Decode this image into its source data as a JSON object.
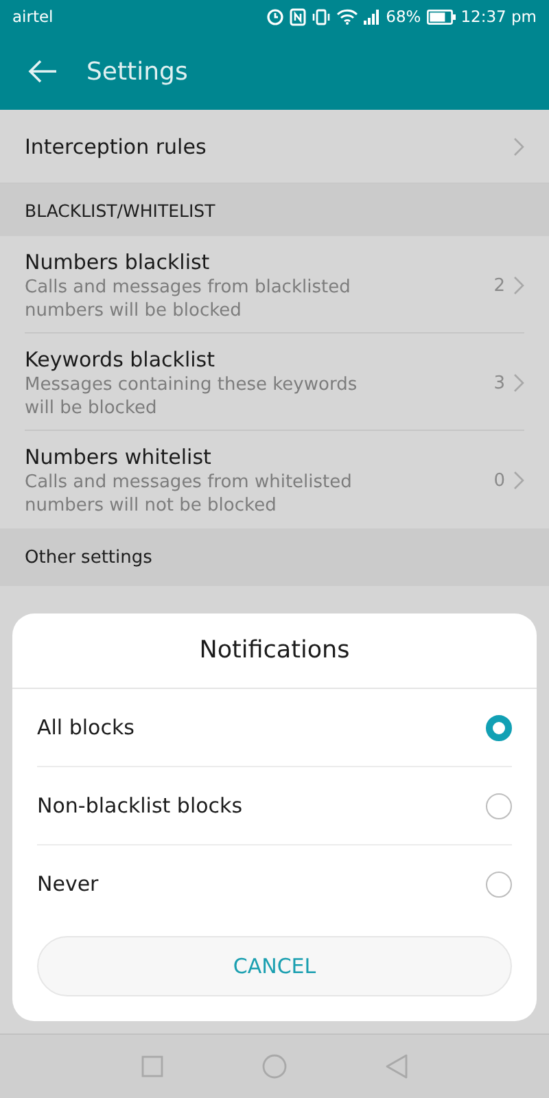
{
  "status_bar": {
    "carrier": "airtel",
    "battery_text": "68%",
    "time": "12:37 pm"
  },
  "app_bar": {
    "title": "Settings"
  },
  "interception_rules": {
    "label": "Interception rules"
  },
  "section": {
    "title": "BLACKLIST/WHITELIST"
  },
  "list_items": [
    {
      "title": "Numbers blacklist",
      "subtitle": "Calls and messages from blacklisted numbers will be blocked",
      "count": "2"
    },
    {
      "title": "Keywords blacklist",
      "subtitle": "Messages containing these keywords will be blocked",
      "count": "3"
    },
    {
      "title": "Numbers whitelist",
      "subtitle": "Calls and messages from whitelisted numbers will not be blocked",
      "count": "0"
    }
  ],
  "other_settings": {
    "title": "Other settings"
  },
  "dialog": {
    "title": "Notifications",
    "options": [
      {
        "label": "All blocks",
        "selected": true
      },
      {
        "label": "Non-blacklist blocks",
        "selected": false
      },
      {
        "label": "Never",
        "selected": false
      }
    ],
    "cancel": "CANCEL"
  }
}
